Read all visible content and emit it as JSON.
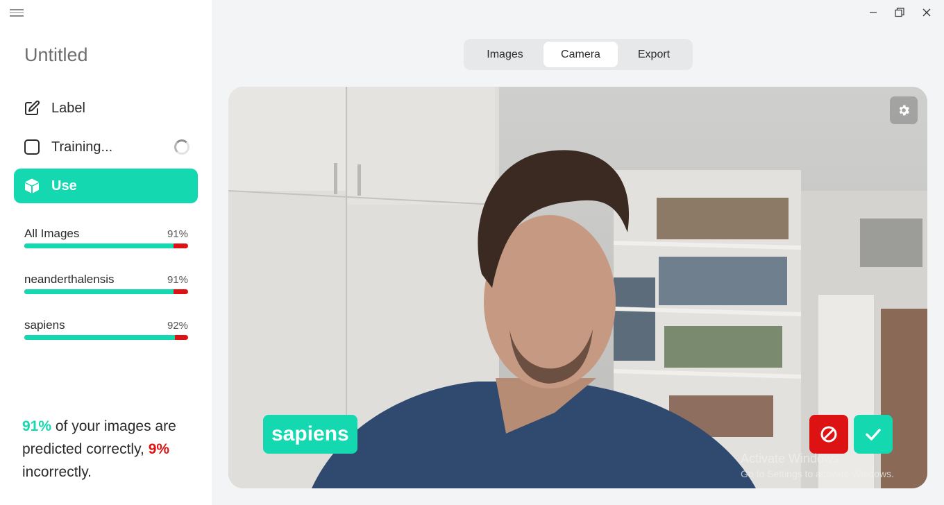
{
  "app": {
    "title": "Untitled"
  },
  "sidebar": {
    "nav": [
      {
        "label": "Label",
        "icon": "edit-icon"
      },
      {
        "label": "Training...",
        "icon": "checkbox-icon"
      },
      {
        "label": "Use",
        "icon": "cube-icon"
      }
    ],
    "classes": [
      {
        "name": "All Images",
        "percent": "91%",
        "accuracy": 0.91
      },
      {
        "name": "neanderthalensis",
        "percent": "91%",
        "accuracy": 0.91
      },
      {
        "name": "sapiens",
        "percent": "92%",
        "accuracy": 0.92
      }
    ],
    "summary": {
      "correct_pct": "91%",
      "correct_text": " of your images are predicted correctly,",
      "incorrect_pct": "9%",
      "incorrect_text": " incorrectly."
    }
  },
  "tabs": [
    "Images",
    "Camera",
    "Export"
  ],
  "active_tab": "Camera",
  "camera": {
    "prediction": "sapiens",
    "watermark_title": "Activate Windows",
    "watermark_subtitle": "Go to Settings to activate Windows."
  },
  "colors": {
    "accent": "#14d9b0",
    "error": "#dd1212"
  }
}
